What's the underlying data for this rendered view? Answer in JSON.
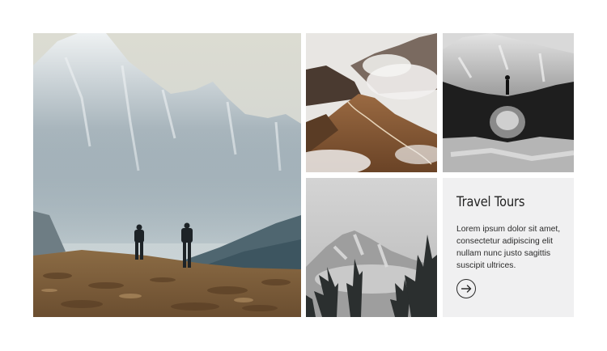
{
  "card": {
    "title": "Travel Tours",
    "description": "Lorem ipsum dolor sit amet, consectetur adipiscing elit nullam nunc justo sagittis suscipit ultrices.",
    "button_icon": "arrow-right-icon"
  },
  "gallery": {
    "images": [
      {
        "name": "mountain-hikers",
        "icon": "photo"
      },
      {
        "name": "mountain-road",
        "icon": "photo"
      },
      {
        "name": "lake-reflection",
        "icon": "photo"
      },
      {
        "name": "snowy-forest",
        "icon": "photo"
      }
    ]
  },
  "colors": {
    "card_background": "#f0f0f1",
    "text": "#222222",
    "page_background": "#ffffff"
  }
}
